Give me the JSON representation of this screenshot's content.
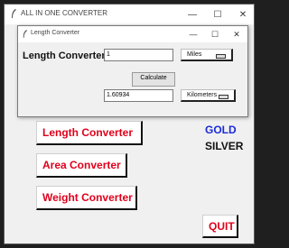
{
  "main_window": {
    "title": "ALL IN ONE CONVERTER",
    "buttons": {
      "length": "Length Converter",
      "area": "Area Converter",
      "weight": "Weight Converter",
      "quit": "QUIT"
    },
    "labels": {
      "gold": "GOLD",
      "silver": "SILVER"
    }
  },
  "length_window": {
    "title": "Length Converter",
    "label": "Length Converter",
    "input_value": "1",
    "from_unit": "Miles",
    "calculate_label": "Calculate",
    "result_value": "1.60934",
    "to_unit": "Kilometers"
  },
  "colors": {
    "accent_red": "#e0001b",
    "gold_blue": "#1a2bd8"
  },
  "window_controls": {
    "minimize": "—",
    "maximize": "☐",
    "close": "✕"
  }
}
